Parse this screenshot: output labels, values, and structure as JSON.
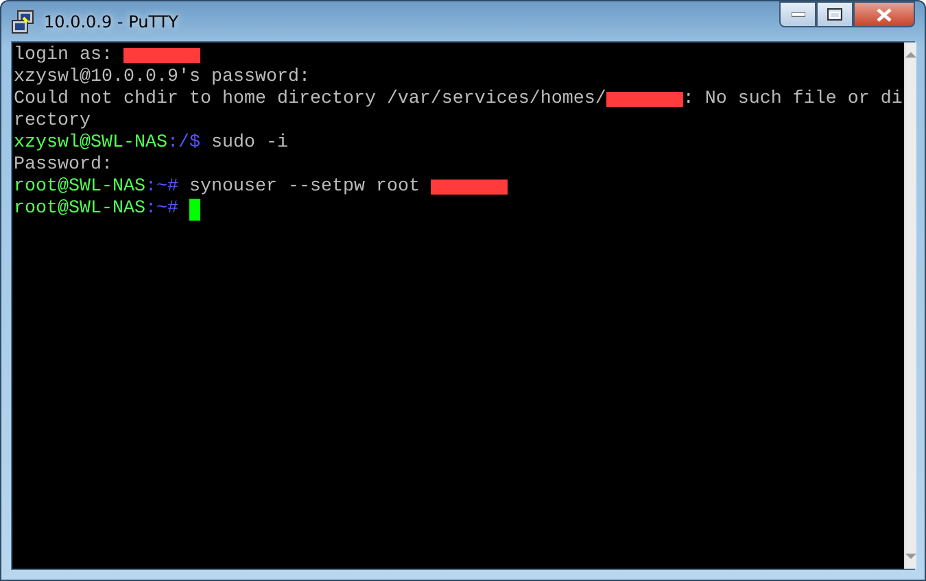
{
  "window": {
    "title": "10.0.0.9 - PuTTY"
  },
  "terminal": {
    "lines": [
      [
        {
          "kind": "text",
          "text": "login as: "
        },
        {
          "kind": "redacted"
        }
      ],
      [
        {
          "kind": "text",
          "text": "xzyswl@10.0.0.9's password:"
        }
      ],
      [
        {
          "kind": "text",
          "text": "Could not chdir to home directory /var/services/homes/"
        },
        {
          "kind": "redacted"
        },
        {
          "kind": "text",
          "text": ": No such file or di"
        }
      ],
      [
        {
          "kind": "text",
          "text": "rectory"
        }
      ],
      [
        {
          "kind": "prompt",
          "text": "xzyswl@SWL-NAS"
        },
        {
          "kind": "path",
          "text": ":/$"
        },
        {
          "kind": "text",
          "text": " sudo -i"
        }
      ],
      [
        {
          "kind": "text",
          "text": "Password:"
        }
      ],
      [
        {
          "kind": "prompt",
          "text": "root@SWL-NAS"
        },
        {
          "kind": "path",
          "text": ":~#"
        },
        {
          "kind": "text",
          "text": " synouser --setpw root "
        },
        {
          "kind": "redacted"
        }
      ],
      [
        {
          "kind": "prompt",
          "text": "root@SWL-NAS"
        },
        {
          "kind": "path",
          "text": ":~#"
        },
        {
          "kind": "cursor"
        }
      ]
    ]
  }
}
